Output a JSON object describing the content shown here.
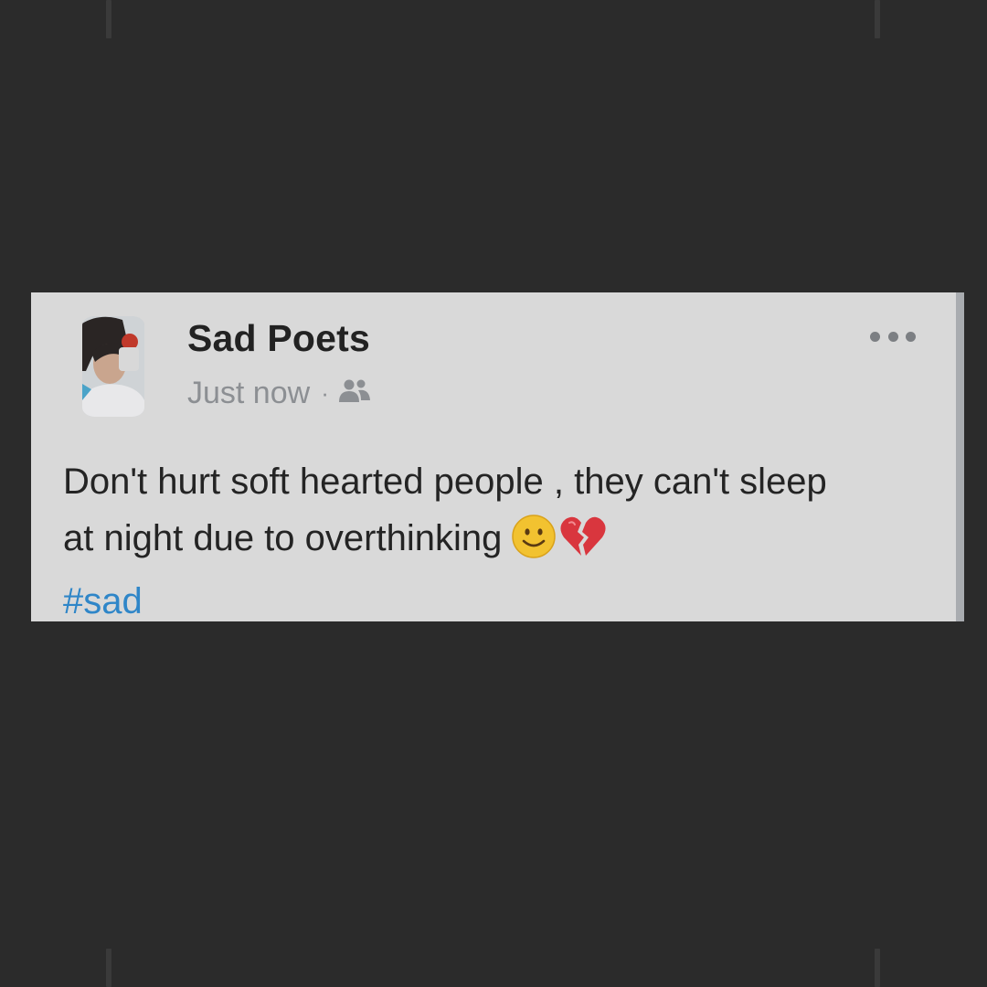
{
  "post": {
    "author": "Sad Poets",
    "timestamp": "Just now",
    "separator": "·",
    "audience_icon": "friends-icon",
    "more_icon": "more-options-icon",
    "text_line_1": "Don't hurt soft hearted people , they can't sleep",
    "text_line_2": "at night due to overthinking",
    "emojis": [
      "slightly-smiling-face",
      "broken-heart"
    ],
    "hashtag": "#sad"
  },
  "colors": {
    "background": "#2b2b2b",
    "card": "#d9d9d9",
    "text": "#242424",
    "meta": "#8c8f93",
    "hashtag": "#2f86c8"
  }
}
